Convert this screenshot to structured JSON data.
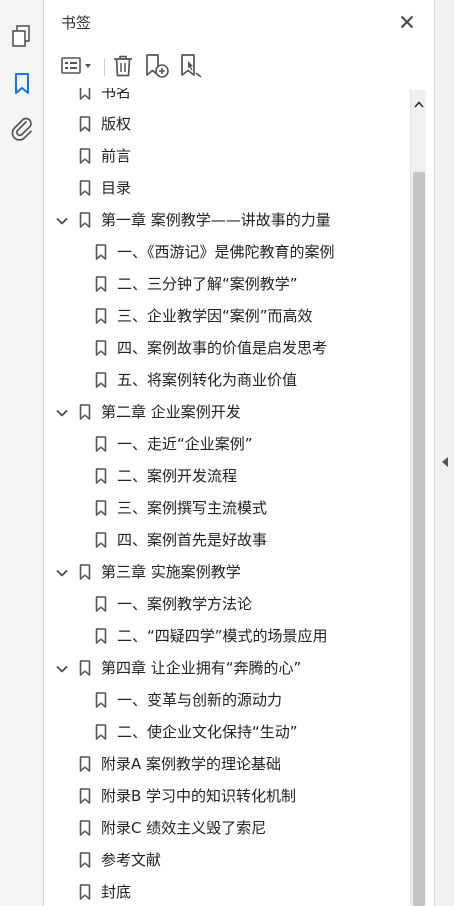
{
  "left_rail": {
    "icons": [
      "page-thumbnails-icon",
      "bookmarks-icon",
      "attachments-icon"
    ],
    "active": "bookmarks-icon",
    "active_color": "#1473e6"
  },
  "panel": {
    "title": "书签",
    "close_icon": "close-icon"
  },
  "toolbar": {
    "icons": [
      "options-menu-icon",
      "delete-bookmark-icon",
      "new-bookmark-icon",
      "bookmark-search-icon"
    ]
  },
  "bookmarks": [
    {
      "label": "书名",
      "level": 0,
      "expandable": false,
      "partial": true
    },
    {
      "label": "版权",
      "level": 0,
      "expandable": false
    },
    {
      "label": "前言",
      "level": 0,
      "expandable": false
    },
    {
      "label": "目录",
      "level": 0,
      "expandable": false
    },
    {
      "label": "第一章  案例教学——讲故事的力量",
      "level": 0,
      "expandable": true,
      "expanded": true
    },
    {
      "label": "一、《西游记》是佛陀教育的案例",
      "level": 1,
      "expandable": false
    },
    {
      "label": "二、三分钟了解“案例教学”",
      "level": 1,
      "expandable": false
    },
    {
      "label": "三、企业教学因“案例”而高效",
      "level": 1,
      "expandable": false
    },
    {
      "label": "四、案例故事的价值是启发思考",
      "level": 1,
      "expandable": false
    },
    {
      "label": "五、将案例转化为商业价值",
      "level": 1,
      "expandable": false
    },
    {
      "label": "第二章  企业案例开发",
      "level": 0,
      "expandable": true,
      "expanded": true
    },
    {
      "label": "一、走近“企业案例”",
      "level": 1,
      "expandable": false
    },
    {
      "label": "二、案例开发流程",
      "level": 1,
      "expandable": false
    },
    {
      "label": "三、案例撰写主流模式",
      "level": 1,
      "expandable": false
    },
    {
      "label": "四、案例首先是好故事",
      "level": 1,
      "expandable": false
    },
    {
      "label": "第三章  实施案例教学",
      "level": 0,
      "expandable": true,
      "expanded": true
    },
    {
      "label": "一、案例教学方法论",
      "level": 1,
      "expandable": false
    },
    {
      "label": "二、“四疑四学”模式的场景应用",
      "level": 1,
      "expandable": false
    },
    {
      "label": "第四章  让企业拥有“奔腾的心”",
      "level": 0,
      "expandable": true,
      "expanded": true
    },
    {
      "label": "一、变革与创新的源动力",
      "level": 1,
      "expandable": false
    },
    {
      "label": "二、使企业文化保持“生动”",
      "level": 1,
      "expandable": false
    },
    {
      "label": "附录A  案例教学的理论基础",
      "level": 0,
      "expandable": false
    },
    {
      "label": "附录B  学习中的知识转化机制",
      "level": 0,
      "expandable": false
    },
    {
      "label": "附录C  绩效主义毁了索尼",
      "level": 0,
      "expandable": false
    },
    {
      "label": "参考文献",
      "level": 0,
      "expandable": false
    },
    {
      "label": "封底",
      "level": 0,
      "expandable": false
    }
  ]
}
